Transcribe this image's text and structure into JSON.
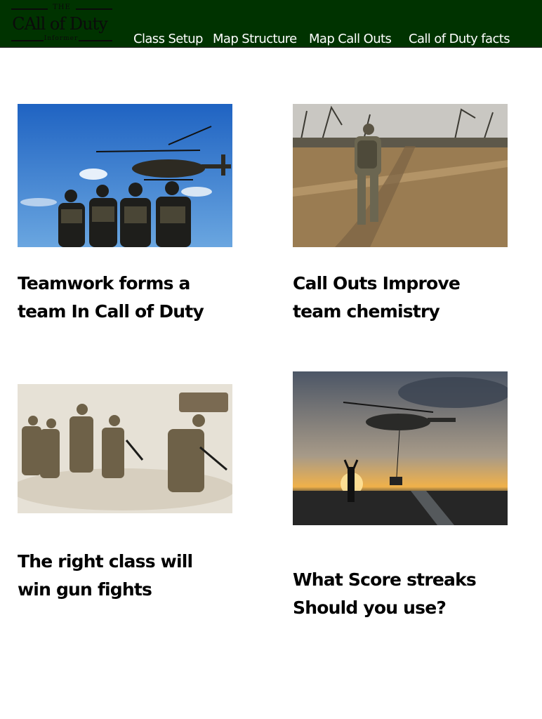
{
  "header": {
    "logo": {
      "top_text": "THE",
      "main_text": "CAll of Duty",
      "bottom_text": "Informer"
    },
    "nav": [
      {
        "label": "Class Setup"
      },
      {
        "label": "Map Structure"
      },
      {
        "label": "Map Call Outs"
      },
      {
        "label": "Call of Duty facts"
      }
    ]
  },
  "cards": [
    {
      "title_line1": "Teamwork forms a",
      "title_line2": "team In Call of Duty",
      "image_icon": "soldiers-helicopter-photo"
    },
    {
      "title_line1": "Call Outs Improve",
      "title_line2": "team chemistry",
      "image_icon": "soldier-field-photo"
    },
    {
      "title_line1": "The right class will",
      "title_line2": "win gun fights",
      "image_icon": "soldiers-running-sand-photo"
    },
    {
      "title_line1": "What Score streaks",
      "title_line2": "Should you use?",
      "image_icon": "helicopter-sunset-photo"
    }
  ],
  "colors": {
    "header_bg": "#003300",
    "nav_text": "#ffffff",
    "title_text": "#000000"
  }
}
